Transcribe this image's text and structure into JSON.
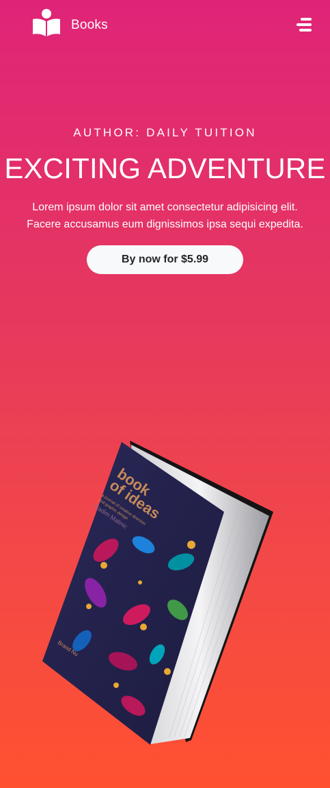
{
  "brand": {
    "name": "Books",
    "logo_icon": "book-reader-icon"
  },
  "nav": {
    "menu_icon": "hamburger-menu-icon"
  },
  "hero": {
    "author": "AUTHOR: DAILY TUITION",
    "title": "EXCITING ADVENTURE",
    "description_line1": "Lorem ipsum dolor sit amet consectetur adipisicing elit.",
    "description_line2": "Facere accusamus eum dignissimos ipsa sequi expedita.",
    "buy_label": "By now for $5.99"
  },
  "book_cover": {
    "title_line1": "book",
    "title_line2": "of ideas",
    "subtitle_line1": "a journal of creative direction",
    "subtitle_line2": "and graphic design",
    "author": "Radim Malinic",
    "publisher": "Brand Nu"
  },
  "colors": {
    "gradient_top": "#df2478",
    "gradient_bottom": "#ff5130",
    "button_bg": "#f8f9fa",
    "button_text": "#212529",
    "cover": "#24234c",
    "cover_title": "#c58a5a"
  }
}
